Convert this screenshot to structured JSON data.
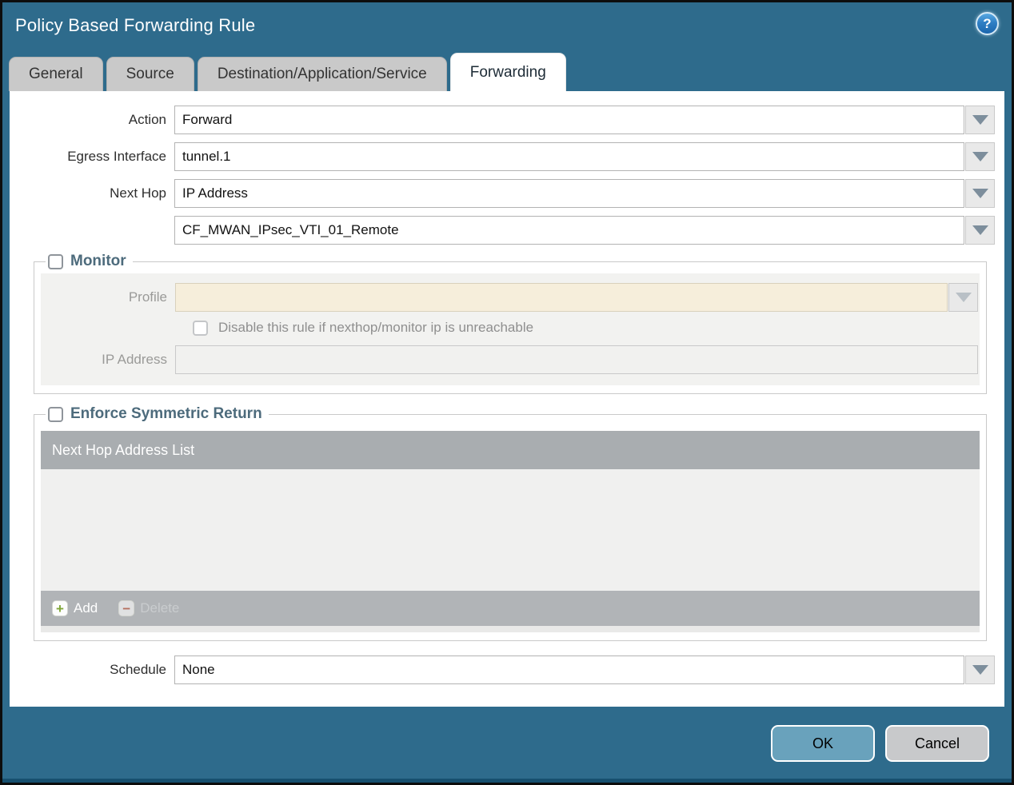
{
  "dialog": {
    "title": "Policy Based Forwarding Rule"
  },
  "icons": {
    "help": "?",
    "add": "+",
    "delete": "−"
  },
  "tabs": [
    {
      "label": "General",
      "active": false
    },
    {
      "label": "Source",
      "active": false
    },
    {
      "label": "Destination/Application/Service",
      "active": false
    },
    {
      "label": "Forwarding",
      "active": true
    }
  ],
  "form": {
    "action": {
      "label": "Action",
      "value": "Forward"
    },
    "egress_interface": {
      "label": "Egress Interface",
      "value": "tunnel.1"
    },
    "next_hop": {
      "label": "Next Hop",
      "value": "IP Address"
    },
    "next_hop_address": {
      "value": "CF_MWAN_IPsec_VTI_01_Remote"
    },
    "schedule": {
      "label": "Schedule",
      "value": "None"
    }
  },
  "monitor": {
    "title": "Monitor",
    "checked": false,
    "profile": {
      "label": "Profile",
      "value": ""
    },
    "disable_rule_checkbox": {
      "label": "Disable this rule if nexthop/monitor ip is unreachable",
      "checked": false
    },
    "ip_address": {
      "label": "IP Address",
      "value": ""
    }
  },
  "symmetric_return": {
    "title": "Enforce Symmetric Return",
    "checked": false,
    "table": {
      "header": "Next Hop Address List",
      "rows": []
    },
    "add_label": "Add",
    "delete_label": "Delete"
  },
  "footer": {
    "ok_label": "OK",
    "cancel_label": "Cancel"
  },
  "colors": {
    "titlebar_teal": "#2e6b8c",
    "ok_button": "#69a2bc",
    "cancel_button": "#c8c9cb",
    "disabled_field_cream": "#f6eedb",
    "list_header_grey": "#a9adb0",
    "section_title": "#4d6b7c",
    "add_icon_green": "#7fa536",
    "delete_icon_red": "#b5705f"
  }
}
